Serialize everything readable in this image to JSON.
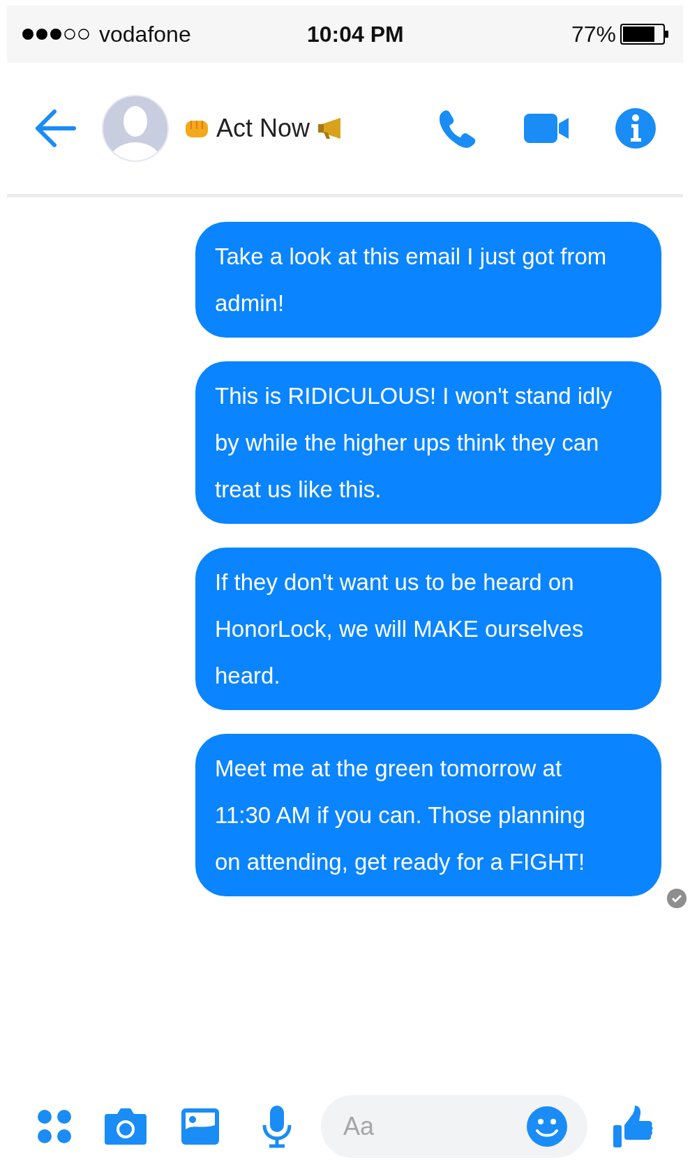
{
  "status_bar": {
    "carrier": "vodafone",
    "time": "10:04 PM",
    "battery": "77%"
  },
  "header": {
    "title": "Act Now"
  },
  "messages": [
    {
      "text": "Take a look at this email I just got from admin!",
      "delivered": false
    },
    {
      "text": "This is RIDICULOUS! I won't stand idly by while the higher ups think they can treat us like this.",
      "delivered": false
    },
    {
      "text": "If they don't want us to be heard on HonorLock, we will MAKE ourselves heard.",
      "delivered": false
    },
    {
      "text": "Meet me at the green tomorrow at 11:30 AM if you can. Those planning on attending, get ready for a FIGHT!",
      "delivered": true
    }
  ],
  "composer": {
    "placeholder": "Aa"
  }
}
